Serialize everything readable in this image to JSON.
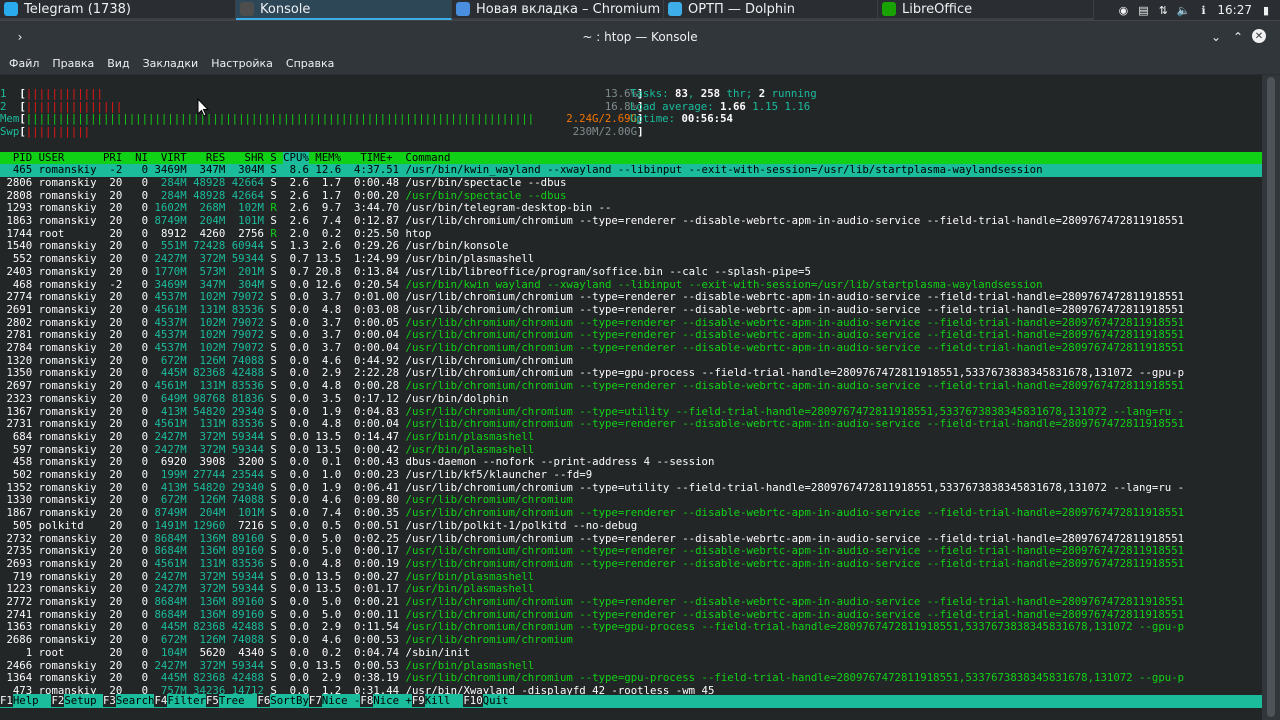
{
  "taskbar": {
    "tasks": [
      {
        "label": "Telegram (1738)",
        "icon": "telegram-icon",
        "color": "#2aabee"
      },
      {
        "label": "Konsole",
        "icon": "konsole-icon",
        "color": "#4d4d4d"
      },
      {
        "label": "Новая вкладка – Chromium",
        "icon": "chromium-icon",
        "color": "#4a8ee0"
      },
      {
        "label": "ОРТП — Dolphin",
        "icon": "dolphin-icon",
        "color": "#3daee9"
      },
      {
        "label": "LibreOffice",
        "icon": "libreoffice-icon",
        "color": "#18a303"
      }
    ],
    "clock": "16:27"
  },
  "window": {
    "title": "~ : htop — Konsole"
  },
  "menu": [
    "Файл",
    "Правка",
    "Вид",
    "Закладки",
    "Настройка",
    "Справка"
  ],
  "htop": {
    "cpu1": {
      "label": "1",
      "bar": "||||||||||||",
      "value": "13.6%"
    },
    "cpu2": {
      "label": "2",
      "bar": "|||||||||||||||",
      "value": "16.8%"
    },
    "mem": {
      "label": "Mem",
      "bar": "|||||||||||||||||||||||||||||||||||||||||||||||||||||||||||||||||||||||||||||||",
      "value": "2.24G/2.69G"
    },
    "swp": {
      "label": "Swp",
      "bar": "||||||||||",
      "value": "230M/2.00G"
    },
    "tasks_line": {
      "prefix": "Tasks: ",
      "tasks": "83",
      "sep": ", ",
      "thr": "258",
      "thr_label": " thr; ",
      "running": "2",
      "running_label": " running"
    },
    "load_line": {
      "prefix": "Load average: ",
      "l1": "1.66",
      "l5": "1.15",
      "l15": "1.16"
    },
    "uptime_line": {
      "prefix": "Uptime: ",
      "value": "00:56:54"
    },
    "columns": "  PID USER      PRI  NI  VIRT   RES   SHR S ",
    "columns_sorted": "CPU%",
    "columns_rest": " MEM%   TIME+  Command",
    "processes": [
      {
        "pid": "465",
        "user": "romanskiy",
        "pri": "-2",
        "ni": "0",
        "virt": "3469M",
        "res": "347M",
        "shr": "304M",
        "s": "S",
        "cpu": "8.6",
        "mem": "12.6",
        "time": "4:37.51",
        "cmd": "/usr/bin/kwin_wayland --xwayland --libinput --exit-with-session=/usr/lib/startplasma-waylandsession",
        "thread": false,
        "selected": true
      },
      {
        "pid": "2806",
        "user": "romanskiy",
        "pri": "20",
        "ni": "0",
        "virt": "284M",
        "res": "48928",
        "shr": "42664",
        "s": "S",
        "cpu": "2.6",
        "mem": "1.7",
        "time": "0:00.48",
        "cmd": "/usr/bin/spectacle --dbus",
        "thread": false
      },
      {
        "pid": "2808",
        "user": "romanskiy",
        "pri": "20",
        "ni": "0",
        "virt": "284M",
        "res": "48928",
        "shr": "42664",
        "s": "S",
        "cpu": "2.6",
        "mem": "1.7",
        "time": "0:00.20",
        "cmd": "/usr/bin/spectacle --dbus",
        "thread": true
      },
      {
        "pid": "1293",
        "user": "romanskiy",
        "pri": "20",
        "ni": "0",
        "virt": "1602M",
        "res": "268M",
        "shr": "102M",
        "s": "R",
        "cpu": "2.6",
        "mem": "9.7",
        "time": "3:44.70",
        "cmd": "/usr/bin/telegram-desktop-bin --",
        "thread": false
      },
      {
        "pid": "1863",
        "user": "romanskiy",
        "pri": "20",
        "ni": "0",
        "virt": "8749M",
        "res": "204M",
        "shr": "101M",
        "s": "S",
        "cpu": "2.6",
        "mem": "7.4",
        "time": "0:12.87",
        "cmd": "/usr/lib/chromium/chromium --type=renderer --disable-webrtc-apm-in-audio-service --field-trial-handle=2809767472811918551",
        "thread": false
      },
      {
        "pid": "1744",
        "user": "root",
        "pri": "20",
        "ni": "0",
        "virt": "8912",
        "res": "4260",
        "shr": "2756",
        "s": "R",
        "cpu": "2.0",
        "mem": "0.2",
        "time": "0:25.50",
        "cmd": "htop",
        "thread": false
      },
      {
        "pid": "1540",
        "user": "romanskiy",
        "pri": "20",
        "ni": "0",
        "virt": "551M",
        "res": "72428",
        "shr": "60944",
        "s": "S",
        "cpu": "1.3",
        "mem": "2.6",
        "time": "0:29.26",
        "cmd": "/usr/bin/konsole",
        "thread": false
      },
      {
        "pid": "552",
        "user": "romanskiy",
        "pri": "20",
        "ni": "0",
        "virt": "2427M",
        "res": "372M",
        "shr": "59344",
        "s": "S",
        "cpu": "0.7",
        "mem": "13.5",
        "time": "1:24.99",
        "cmd": "/usr/bin/plasmashell",
        "thread": false
      },
      {
        "pid": "2403",
        "user": "romanskiy",
        "pri": "20",
        "ni": "0",
        "virt": "1770M",
        "res": "573M",
        "shr": "201M",
        "s": "S",
        "cpu": "0.7",
        "mem": "20.8",
        "time": "0:13.84",
        "cmd": "/usr/lib/libreoffice/program/soffice.bin --calc --splash-pipe=5",
        "thread": false
      },
      {
        "pid": "468",
        "user": "romanskiy",
        "pri": "-2",
        "ni": "0",
        "virt": "3469M",
        "res": "347M",
        "shr": "304M",
        "s": "S",
        "cpu": "0.0",
        "mem": "12.6",
        "time": "0:20.54",
        "cmd": "/usr/bin/kwin_wayland --xwayland --libinput --exit-with-session=/usr/lib/startplasma-waylandsession",
        "thread": true
      },
      {
        "pid": "2774",
        "user": "romanskiy",
        "pri": "20",
        "ni": "0",
        "virt": "4537M",
        "res": "102M",
        "shr": "79072",
        "s": "S",
        "cpu": "0.0",
        "mem": "3.7",
        "time": "0:01.00",
        "cmd": "/usr/lib/chromium/chromium --type=renderer --disable-webrtc-apm-in-audio-service --field-trial-handle=2809767472811918551",
        "thread": false
      },
      {
        "pid": "2691",
        "user": "romanskiy",
        "pri": "20",
        "ni": "0",
        "virt": "4561M",
        "res": "131M",
        "shr": "83536",
        "s": "S",
        "cpu": "0.0",
        "mem": "4.8",
        "time": "0:03.08",
        "cmd": "/usr/lib/chromium/chromium --type=renderer --disable-webrtc-apm-in-audio-service --field-trial-handle=2809767472811918551",
        "thread": false
      },
      {
        "pid": "2802",
        "user": "romanskiy",
        "pri": "20",
        "ni": "0",
        "virt": "4537M",
        "res": "102M",
        "shr": "79072",
        "s": "S",
        "cpu": "0.0",
        "mem": "3.7",
        "time": "0:00.05",
        "cmd": "/usr/lib/chromium/chromium --type=renderer --disable-webrtc-apm-in-audio-service --field-trial-handle=2809767472811918551",
        "thread": true
      },
      {
        "pid": "2781",
        "user": "romanskiy",
        "pri": "20",
        "ni": "0",
        "virt": "4537M",
        "res": "102M",
        "shr": "79072",
        "s": "S",
        "cpu": "0.0",
        "mem": "3.7",
        "time": "0:00.04",
        "cmd": "/usr/lib/chromium/chromium --type=renderer --disable-webrtc-apm-in-audio-service --field-trial-handle=2809767472811918551",
        "thread": true
      },
      {
        "pid": "2784",
        "user": "romanskiy",
        "pri": "20",
        "ni": "0",
        "virt": "4537M",
        "res": "102M",
        "shr": "79072",
        "s": "S",
        "cpu": "0.0",
        "mem": "3.7",
        "time": "0:00.04",
        "cmd": "/usr/lib/chromium/chromium --type=renderer --disable-webrtc-apm-in-audio-service --field-trial-handle=2809767472811918551",
        "thread": true
      },
      {
        "pid": "1320",
        "user": "romanskiy",
        "pri": "20",
        "ni": "0",
        "virt": "672M",
        "res": "126M",
        "shr": "74088",
        "s": "S",
        "cpu": "0.0",
        "mem": "4.6",
        "time": "0:44.92",
        "cmd": "/usr/lib/chromium/chromium",
        "thread": false
      },
      {
        "pid": "1350",
        "user": "romanskiy",
        "pri": "20",
        "ni": "0",
        "virt": "445M",
        "res": "82368",
        "shr": "42488",
        "s": "S",
        "cpu": "0.0",
        "mem": "2.9",
        "time": "2:22.28",
        "cmd": "/usr/lib/chromium/chromium --type=gpu-process --field-trial-handle=2809767472811918551,5337673838345831678,131072 --gpu-p",
        "thread": false
      },
      {
        "pid": "2697",
        "user": "romanskiy",
        "pri": "20",
        "ni": "0",
        "virt": "4561M",
        "res": "131M",
        "shr": "83536",
        "s": "S",
        "cpu": "0.0",
        "mem": "4.8",
        "time": "0:00.28",
        "cmd": "/usr/lib/chromium/chromium --type=renderer --disable-webrtc-apm-in-audio-service --field-trial-handle=2809767472811918551",
        "thread": true
      },
      {
        "pid": "2323",
        "user": "romanskiy",
        "pri": "20",
        "ni": "0",
        "virt": "649M",
        "res": "98768",
        "shr": "81836",
        "s": "S",
        "cpu": "0.0",
        "mem": "3.5",
        "time": "0:17.12",
        "cmd": "/usr/bin/dolphin",
        "thread": false
      },
      {
        "pid": "1367",
        "user": "romanskiy",
        "pri": "20",
        "ni": "0",
        "virt": "413M",
        "res": "54820",
        "shr": "29340",
        "s": "S",
        "cpu": "0.0",
        "mem": "1.9",
        "time": "0:04.83",
        "cmd": "/usr/lib/chromium/chromium --type=utility --field-trial-handle=2809767472811918551,5337673838345831678,131072 --lang=ru -",
        "thread": true
      },
      {
        "pid": "2731",
        "user": "romanskiy",
        "pri": "20",
        "ni": "0",
        "virt": "4561M",
        "res": "131M",
        "shr": "83536",
        "s": "S",
        "cpu": "0.0",
        "mem": "4.8",
        "time": "0:00.04",
        "cmd": "/usr/lib/chromium/chromium --type=renderer --disable-webrtc-apm-in-audio-service --field-trial-handle=2809767472811918551",
        "thread": true
      },
      {
        "pid": "684",
        "user": "romanskiy",
        "pri": "20",
        "ni": "0",
        "virt": "2427M",
        "res": "372M",
        "shr": "59344",
        "s": "S",
        "cpu": "0.0",
        "mem": "13.5",
        "time": "0:14.47",
        "cmd": "/usr/bin/plasmashell",
        "thread": true
      },
      {
        "pid": "597",
        "user": "romanskiy",
        "pri": "20",
        "ni": "0",
        "virt": "2427M",
        "res": "372M",
        "shr": "59344",
        "s": "S",
        "cpu": "0.0",
        "mem": "13.5",
        "time": "0:00.42",
        "cmd": "/usr/bin/plasmashell",
        "thread": true
      },
      {
        "pid": "458",
        "user": "romanskiy",
        "pri": "20",
        "ni": "0",
        "virt": "6920",
        "res": "3908",
        "shr": "3200",
        "s": "S",
        "cpu": "0.0",
        "mem": "0.1",
        "time": "0:00.43",
        "cmd": "dbus-daemon --nofork --print-address 4 --session",
        "thread": false
      },
      {
        "pid": "502",
        "user": "romanskiy",
        "pri": "20",
        "ni": "0",
        "virt": "199M",
        "res": "27744",
        "shr": "23544",
        "s": "S",
        "cpu": "0.0",
        "mem": "1.0",
        "time": "0:00.23",
        "cmd": "/usr/lib/kf5/klauncher --fd=9",
        "thread": false
      },
      {
        "pid": "1352",
        "user": "romanskiy",
        "pri": "20",
        "ni": "0",
        "virt": "413M",
        "res": "54820",
        "shr": "29340",
        "s": "S",
        "cpu": "0.0",
        "mem": "1.9",
        "time": "0:06.41",
        "cmd": "/usr/lib/chromium/chromium --type=utility --field-trial-handle=2809767472811918551,5337673838345831678,131072 --lang=ru -",
        "thread": false
      },
      {
        "pid": "1330",
        "user": "romanskiy",
        "pri": "20",
        "ni": "0",
        "virt": "672M",
        "res": "126M",
        "shr": "74088",
        "s": "S",
        "cpu": "0.0",
        "mem": "4.6",
        "time": "0:09.80",
        "cmd": "/usr/lib/chromium/chromium",
        "thread": true
      },
      {
        "pid": "1867",
        "user": "romanskiy",
        "pri": "20",
        "ni": "0",
        "virt": "8749M",
        "res": "204M",
        "shr": "101M",
        "s": "S",
        "cpu": "0.0",
        "mem": "7.4",
        "time": "0:00.35",
        "cmd": "/usr/lib/chromium/chromium --type=renderer --disable-webrtc-apm-in-audio-service --field-trial-handle=2809767472811918551",
        "thread": true
      },
      {
        "pid": "505",
        "user": "polkitd",
        "pri": "20",
        "ni": "0",
        "virt": "1491M",
        "res": "12960",
        "shr": "7216",
        "s": "S",
        "cpu": "0.0",
        "mem": "0.5",
        "time": "0:00.51",
        "cmd": "/usr/lib/polkit-1/polkitd --no-debug",
        "thread": false
      },
      {
        "pid": "2732",
        "user": "romanskiy",
        "pri": "20",
        "ni": "0",
        "virt": "8684M",
        "res": "136M",
        "shr": "89160",
        "s": "S",
        "cpu": "0.0",
        "mem": "5.0",
        "time": "0:02.25",
        "cmd": "/usr/lib/chromium/chromium --type=renderer --disable-webrtc-apm-in-audio-service --field-trial-handle=2809767472811918551",
        "thread": false
      },
      {
        "pid": "2735",
        "user": "romanskiy",
        "pri": "20",
        "ni": "0",
        "virt": "8684M",
        "res": "136M",
        "shr": "89160",
        "s": "S",
        "cpu": "0.0",
        "mem": "5.0",
        "time": "0:00.17",
        "cmd": "/usr/lib/chromium/chromium --type=renderer --disable-webrtc-apm-in-audio-service --field-trial-handle=2809767472811918551",
        "thread": true
      },
      {
        "pid": "2693",
        "user": "romanskiy",
        "pri": "20",
        "ni": "0",
        "virt": "4561M",
        "res": "131M",
        "shr": "83536",
        "s": "S",
        "cpu": "0.0",
        "mem": "4.8",
        "time": "0:00.19",
        "cmd": "/usr/lib/chromium/chromium --type=renderer --disable-webrtc-apm-in-audio-service --field-trial-handle=2809767472811918551",
        "thread": true
      },
      {
        "pid": "719",
        "user": "romanskiy",
        "pri": "20",
        "ni": "0",
        "virt": "2427M",
        "res": "372M",
        "shr": "59344",
        "s": "S",
        "cpu": "0.0",
        "mem": "13.5",
        "time": "0:00.27",
        "cmd": "/usr/bin/plasmashell",
        "thread": true
      },
      {
        "pid": "1223",
        "user": "romanskiy",
        "pri": "20",
        "ni": "0",
        "virt": "2427M",
        "res": "372M",
        "shr": "59344",
        "s": "S",
        "cpu": "0.0",
        "mem": "13.5",
        "time": "0:01.17",
        "cmd": "/usr/bin/plasmashell",
        "thread": true
      },
      {
        "pid": "2772",
        "user": "romanskiy",
        "pri": "20",
        "ni": "0",
        "virt": "8684M",
        "res": "136M",
        "shr": "89160",
        "s": "S",
        "cpu": "0.0",
        "mem": "5.0",
        "time": "0:00.21",
        "cmd": "/usr/lib/chromium/chromium --type=renderer --disable-webrtc-apm-in-audio-service --field-trial-handle=2809767472811918551",
        "thread": true
      },
      {
        "pid": "2741",
        "user": "romanskiy",
        "pri": "20",
        "ni": "0",
        "virt": "8684M",
        "res": "136M",
        "shr": "89160",
        "s": "S",
        "cpu": "0.0",
        "mem": "5.0",
        "time": "0:00.11",
        "cmd": "/usr/lib/chromium/chromium --type=renderer --disable-webrtc-apm-in-audio-service --field-trial-handle=2809767472811918551",
        "thread": true
      },
      {
        "pid": "1363",
        "user": "romanskiy",
        "pri": "20",
        "ni": "0",
        "virt": "445M",
        "res": "82368",
        "shr": "42488",
        "s": "S",
        "cpu": "0.0",
        "mem": "2.9",
        "time": "0:11.54",
        "cmd": "/usr/lib/chromium/chromium --type=gpu-process --field-trial-handle=2809767472811918551,5337673838345831678,131072 --gpu-p",
        "thread": true
      },
      {
        "pid": "2686",
        "user": "romanskiy",
        "pri": "20",
        "ni": "0",
        "virt": "672M",
        "res": "126M",
        "shr": "74088",
        "s": "S",
        "cpu": "0.0",
        "mem": "4.6",
        "time": "0:00.53",
        "cmd": "/usr/lib/chromium/chromium",
        "thread": true
      },
      {
        "pid": "1",
        "user": "root",
        "pri": "20",
        "ni": "0",
        "virt": "104M",
        "res": "5620",
        "shr": "4340",
        "s": "S",
        "cpu": "0.0",
        "mem": "0.2",
        "time": "0:04.74",
        "cmd": "/sbin/init",
        "thread": false
      },
      {
        "pid": "2466",
        "user": "romanskiy",
        "pri": "20",
        "ni": "0",
        "virt": "2427M",
        "res": "372M",
        "shr": "59344",
        "s": "S",
        "cpu": "0.0",
        "mem": "13.5",
        "time": "0:00.53",
        "cmd": "/usr/bin/plasmashell",
        "thread": true
      },
      {
        "pid": "1364",
        "user": "romanskiy",
        "pri": "20",
        "ni": "0",
        "virt": "445M",
        "res": "82368",
        "shr": "42488",
        "s": "S",
        "cpu": "0.0",
        "mem": "2.9",
        "time": "0:38.19",
        "cmd": "/usr/lib/chromium/chromium --type=gpu-process --field-trial-handle=2809767472811918551,5337673838345831678,131072 --gpu-p",
        "thread": true
      },
      {
        "pid": "473",
        "user": "romanskiy",
        "pri": "20",
        "ni": "0",
        "virt": "757M",
        "res": "34236",
        "shr": "14712",
        "s": "S",
        "cpu": "0.0",
        "mem": "1.2",
        "time": "0:31.44",
        "cmd": "/usr/bin/Xwayland -displayfd 42 -rootless -wm 45",
        "thread": false
      }
    ],
    "fkeys": [
      {
        "key": "F1",
        "label": "Help  "
      },
      {
        "key": "F2",
        "label": "Setup "
      },
      {
        "key": "F3",
        "label": "Search"
      },
      {
        "key": "F4",
        "label": "Filter"
      },
      {
        "key": "F5",
        "label": "Tree  "
      },
      {
        "key": "F6",
        "label": "SortBy"
      },
      {
        "key": "F7",
        "label": "Nice -"
      },
      {
        "key": "F8",
        "label": "Nice +"
      },
      {
        "key": "F9",
        "label": "Kill  "
      },
      {
        "key": "F10",
        "label": "Quit"
      }
    ]
  }
}
